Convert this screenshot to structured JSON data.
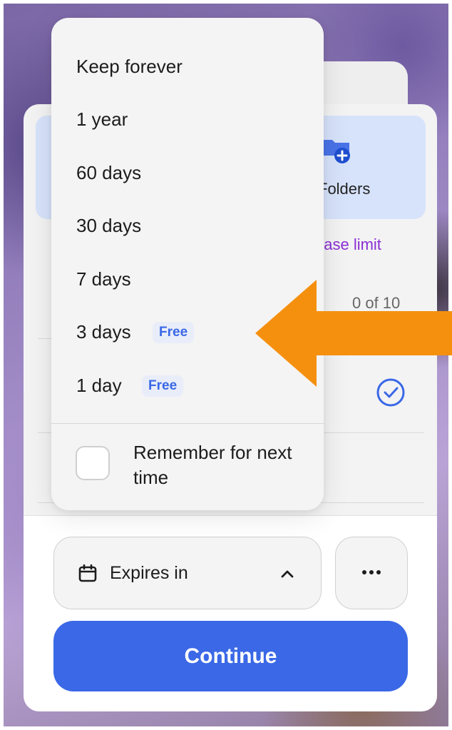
{
  "background_card": {
    "folders_label": "Folders",
    "limit_link": "ease limit",
    "count_text": "0 of 10"
  },
  "dropdown": {
    "options": [
      {
        "label": "Keep forever",
        "badge": ""
      },
      {
        "label": "1 year",
        "badge": ""
      },
      {
        "label": "60 days",
        "badge": ""
      },
      {
        "label": "30 days",
        "badge": ""
      },
      {
        "label": "7 days",
        "badge": ""
      },
      {
        "label": "3 days",
        "badge": "Free"
      },
      {
        "label": "1 day",
        "badge": "Free"
      }
    ],
    "remember_label": "Remember for next time",
    "remember_checked": false
  },
  "bottom": {
    "expires_label": "Expires in",
    "continue_label": "Continue"
  },
  "icons": {
    "calendar": "calendar-icon",
    "chevron": "chevron-up-icon",
    "more": "more-horizontal-icon",
    "check": "check-circle-icon",
    "folder": "folder-add-icon",
    "arrow": "arrow-left-annotation"
  },
  "colors": {
    "accent": "#3a68e6",
    "link": "#8a2ed6",
    "annotation": "#f5900f",
    "tile": "#d7e3fb"
  }
}
